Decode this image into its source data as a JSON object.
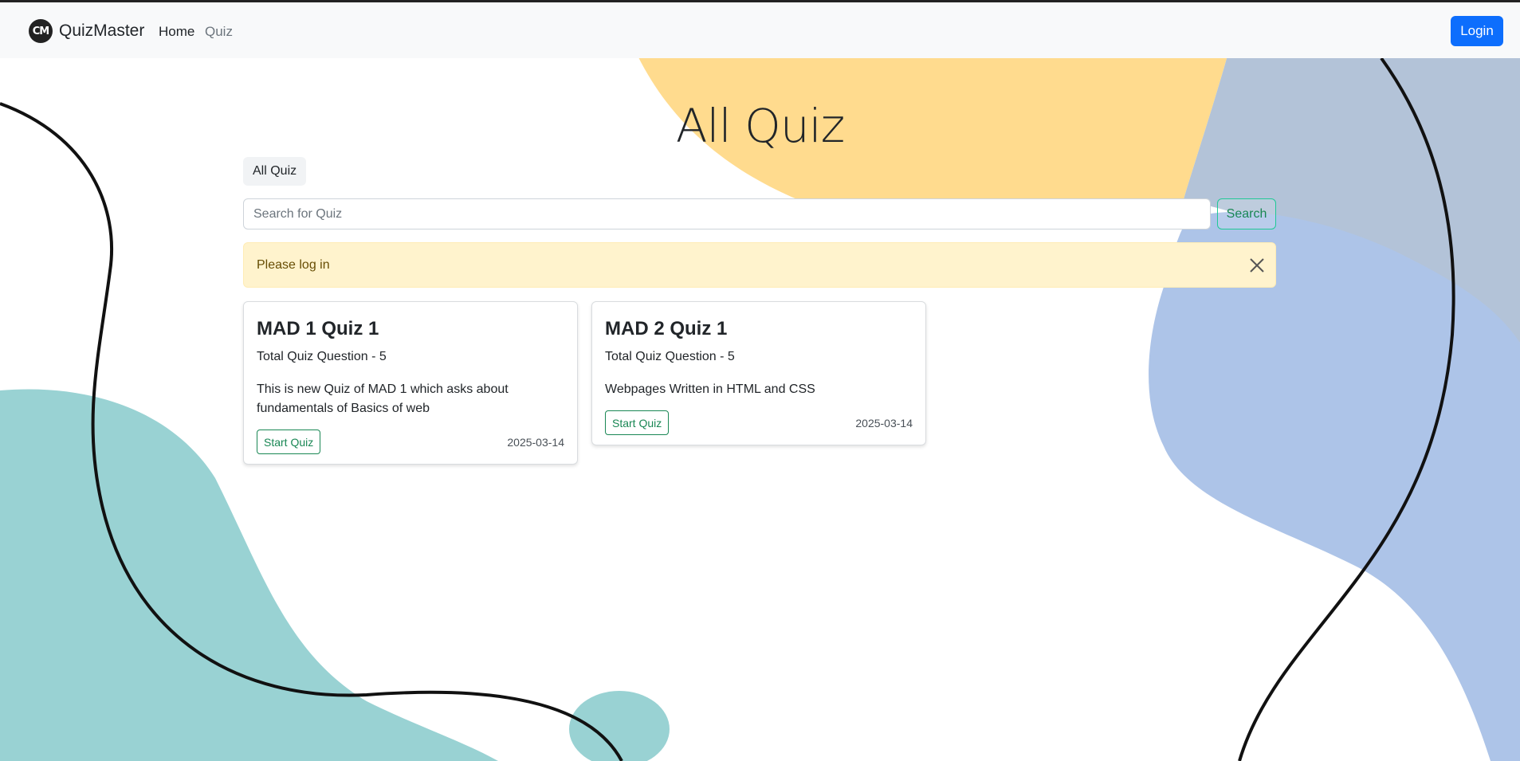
{
  "navbar": {
    "logo_text": "CM",
    "brand": "QuizMaster",
    "links": [
      "Home",
      "Quiz"
    ],
    "login_label": "Login"
  },
  "page": {
    "title": "All Quiz",
    "breadcrumb": "All Quiz"
  },
  "search": {
    "placeholder": "Search for Quiz",
    "value": "",
    "button_label": "Search"
  },
  "alert": {
    "message": "Please log in"
  },
  "quizzes": [
    {
      "title": "MAD 1 Quiz 1",
      "subtitle": "Total Quiz Question - 5",
      "description": "This is new Quiz of MAD 1 which asks about fundamentals of Basics of web",
      "button_label": "Start Quiz",
      "date": "2025-03-14"
    },
    {
      "title": "MAD 2 Quiz 1",
      "subtitle": "Total Quiz Question - 5",
      "description": "Webpages Written in HTML and CSS",
      "button_label": "Start Quiz",
      "date": "2025-03-14"
    }
  ],
  "colors": {
    "primary": "#0d6efd",
    "success": "#198754",
    "alert_bg": "#fff3cd",
    "blob_yellow": "#ffdb8e",
    "blob_blue": "#adc4e8",
    "blob_teal": "#99d2d3"
  }
}
